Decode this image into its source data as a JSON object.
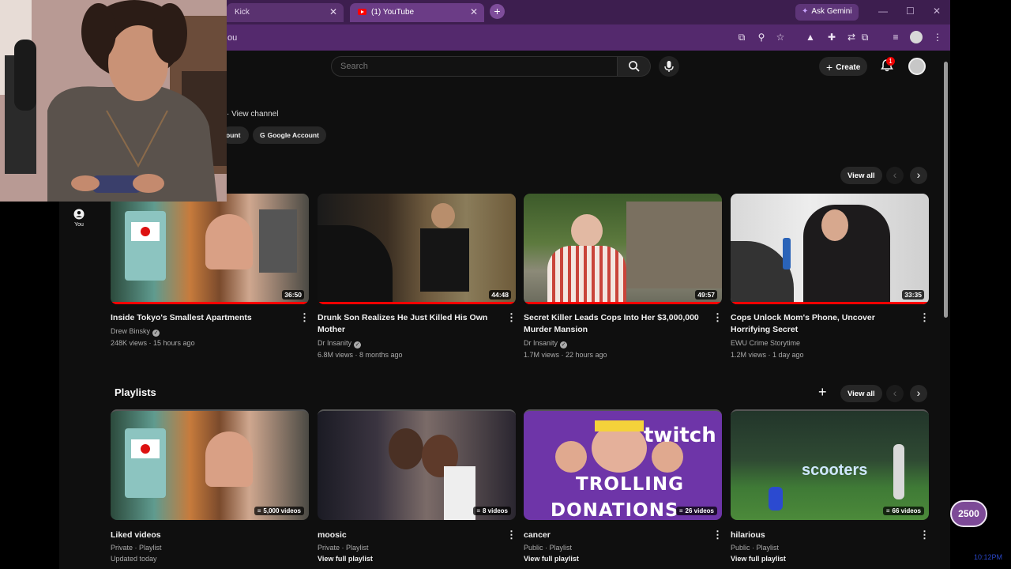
{
  "browser": {
    "tabs": [
      {
        "title": "Kick",
        "active": false
      },
      {
        "title": "(1) YouTube",
        "active": true
      }
    ],
    "ask_gemini_label": "Ask Gemini",
    "url_text": "ou",
    "theme_color": "#54296d"
  },
  "header": {
    "search_placeholder": "Search",
    "create_label": "Create",
    "notification_count": "1"
  },
  "channel": {
    "view_channel_label": "· View channel",
    "chips": [
      "ount",
      "Google Account"
    ]
  },
  "sidebar": {
    "you_label": "You"
  },
  "history_section": {
    "view_all_label": "View all",
    "videos": [
      {
        "title": "Inside Tokyo's Smallest Apartments",
        "channel": "Drew Binsky",
        "verified": true,
        "views": "248K views",
        "age": "15 hours ago",
        "duration": "36:50",
        "watched_fraction": 1.0
      },
      {
        "title": "Drunk Son Realizes He Just Killed His Own Mother",
        "channel": "Dr Insanity",
        "verified": true,
        "views": "6.8M views",
        "age": "8 months ago",
        "duration": "44:48",
        "watched_fraction": 1.0
      },
      {
        "title": "Secret Killer Leads Cops Into Her $3,000,000 Murder Mansion",
        "channel": "Dr Insanity",
        "verified": true,
        "views": "1.7M views",
        "age": "22 hours ago",
        "duration": "49:57",
        "watched_fraction": 1.0
      },
      {
        "title": "Cops Unlock Mom's Phone, Uncover Horrifying Secret",
        "channel": "EWU Crime Storytime",
        "verified": false,
        "views": "1.2M views",
        "age": "1 day ago",
        "duration": "33:35",
        "watched_fraction": 1.0
      }
    ]
  },
  "playlists_section": {
    "heading": "Playlists",
    "view_all_label": "View all",
    "playlists": [
      {
        "title": "Liked videos",
        "privacy": "Private · Playlist",
        "extra": "Updated today",
        "count": "5,000 videos"
      },
      {
        "title": "moosic",
        "privacy": "Private · Playlist",
        "extra": "View full playlist",
        "count": "8 videos"
      },
      {
        "title": "cancer",
        "privacy": "Public · Playlist",
        "extra": "View full playlist",
        "count": "26 videos",
        "thumb_text": [
          "TROLLING",
          "DONATIONS",
          "twitch"
        ]
      },
      {
        "title": "hilarious",
        "privacy": "Public · Playlist",
        "extra": "View full playlist",
        "count": "66 videos",
        "thumb_text": [
          "scooters"
        ]
      }
    ]
  },
  "overlays": {
    "points": "2500",
    "clock": "10:12PM"
  },
  "icons": {
    "search": "search-icon",
    "mic": "mic-icon",
    "bell": "bell-icon",
    "user": "user-icon",
    "kebab": "more-vert-icon"
  }
}
